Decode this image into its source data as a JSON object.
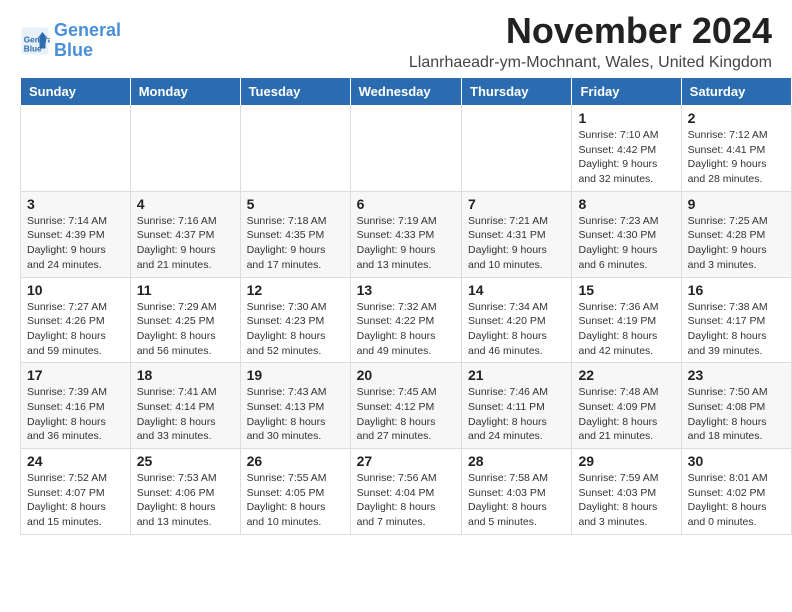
{
  "header": {
    "logo_line1": "General",
    "logo_line2": "Blue",
    "title": "November 2024",
    "location": "Llanrhaeadr-ym-Mochnant, Wales, United Kingdom"
  },
  "days_of_week": [
    "Sunday",
    "Monday",
    "Tuesday",
    "Wednesday",
    "Thursday",
    "Friday",
    "Saturday"
  ],
  "weeks": [
    [
      {
        "day": "",
        "info": ""
      },
      {
        "day": "",
        "info": ""
      },
      {
        "day": "",
        "info": ""
      },
      {
        "day": "",
        "info": ""
      },
      {
        "day": "",
        "info": ""
      },
      {
        "day": "1",
        "info": "Sunrise: 7:10 AM\nSunset: 4:42 PM\nDaylight: 9 hours and 32 minutes."
      },
      {
        "day": "2",
        "info": "Sunrise: 7:12 AM\nSunset: 4:41 PM\nDaylight: 9 hours and 28 minutes."
      }
    ],
    [
      {
        "day": "3",
        "info": "Sunrise: 7:14 AM\nSunset: 4:39 PM\nDaylight: 9 hours and 24 minutes."
      },
      {
        "day": "4",
        "info": "Sunrise: 7:16 AM\nSunset: 4:37 PM\nDaylight: 9 hours and 21 minutes."
      },
      {
        "day": "5",
        "info": "Sunrise: 7:18 AM\nSunset: 4:35 PM\nDaylight: 9 hours and 17 minutes."
      },
      {
        "day": "6",
        "info": "Sunrise: 7:19 AM\nSunset: 4:33 PM\nDaylight: 9 hours and 13 minutes."
      },
      {
        "day": "7",
        "info": "Sunrise: 7:21 AM\nSunset: 4:31 PM\nDaylight: 9 hours and 10 minutes."
      },
      {
        "day": "8",
        "info": "Sunrise: 7:23 AM\nSunset: 4:30 PM\nDaylight: 9 hours and 6 minutes."
      },
      {
        "day": "9",
        "info": "Sunrise: 7:25 AM\nSunset: 4:28 PM\nDaylight: 9 hours and 3 minutes."
      }
    ],
    [
      {
        "day": "10",
        "info": "Sunrise: 7:27 AM\nSunset: 4:26 PM\nDaylight: 8 hours and 59 minutes."
      },
      {
        "day": "11",
        "info": "Sunrise: 7:29 AM\nSunset: 4:25 PM\nDaylight: 8 hours and 56 minutes."
      },
      {
        "day": "12",
        "info": "Sunrise: 7:30 AM\nSunset: 4:23 PM\nDaylight: 8 hours and 52 minutes."
      },
      {
        "day": "13",
        "info": "Sunrise: 7:32 AM\nSunset: 4:22 PM\nDaylight: 8 hours and 49 minutes."
      },
      {
        "day": "14",
        "info": "Sunrise: 7:34 AM\nSunset: 4:20 PM\nDaylight: 8 hours and 46 minutes."
      },
      {
        "day": "15",
        "info": "Sunrise: 7:36 AM\nSunset: 4:19 PM\nDaylight: 8 hours and 42 minutes."
      },
      {
        "day": "16",
        "info": "Sunrise: 7:38 AM\nSunset: 4:17 PM\nDaylight: 8 hours and 39 minutes."
      }
    ],
    [
      {
        "day": "17",
        "info": "Sunrise: 7:39 AM\nSunset: 4:16 PM\nDaylight: 8 hours and 36 minutes."
      },
      {
        "day": "18",
        "info": "Sunrise: 7:41 AM\nSunset: 4:14 PM\nDaylight: 8 hours and 33 minutes."
      },
      {
        "day": "19",
        "info": "Sunrise: 7:43 AM\nSunset: 4:13 PM\nDaylight: 8 hours and 30 minutes."
      },
      {
        "day": "20",
        "info": "Sunrise: 7:45 AM\nSunset: 4:12 PM\nDaylight: 8 hours and 27 minutes."
      },
      {
        "day": "21",
        "info": "Sunrise: 7:46 AM\nSunset: 4:11 PM\nDaylight: 8 hours and 24 minutes."
      },
      {
        "day": "22",
        "info": "Sunrise: 7:48 AM\nSunset: 4:09 PM\nDaylight: 8 hours and 21 minutes."
      },
      {
        "day": "23",
        "info": "Sunrise: 7:50 AM\nSunset: 4:08 PM\nDaylight: 8 hours and 18 minutes."
      }
    ],
    [
      {
        "day": "24",
        "info": "Sunrise: 7:52 AM\nSunset: 4:07 PM\nDaylight: 8 hours and 15 minutes."
      },
      {
        "day": "25",
        "info": "Sunrise: 7:53 AM\nSunset: 4:06 PM\nDaylight: 8 hours and 13 minutes."
      },
      {
        "day": "26",
        "info": "Sunrise: 7:55 AM\nSunset: 4:05 PM\nDaylight: 8 hours and 10 minutes."
      },
      {
        "day": "27",
        "info": "Sunrise: 7:56 AM\nSunset: 4:04 PM\nDaylight: 8 hours and 7 minutes."
      },
      {
        "day": "28",
        "info": "Sunrise: 7:58 AM\nSunset: 4:03 PM\nDaylight: 8 hours and 5 minutes."
      },
      {
        "day": "29",
        "info": "Sunrise: 7:59 AM\nSunset: 4:03 PM\nDaylight: 8 hours and 3 minutes."
      },
      {
        "day": "30",
        "info": "Sunrise: 8:01 AM\nSunset: 4:02 PM\nDaylight: 8 hours and 0 minutes."
      }
    ]
  ]
}
